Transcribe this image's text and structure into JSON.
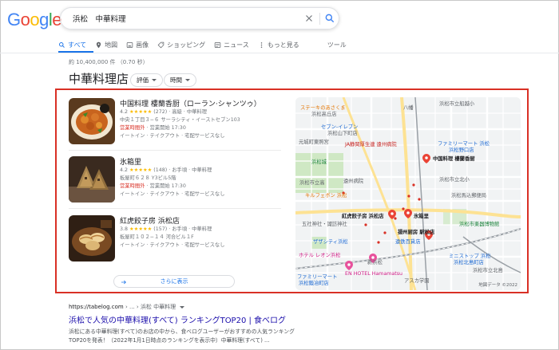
{
  "logo": "Google",
  "search": {
    "query": "浜松　中華料理"
  },
  "tabs": [
    {
      "label": "すべて",
      "icon": "search-icon"
    },
    {
      "label": "地図",
      "icon": "map-pin-icon"
    },
    {
      "label": "画像",
      "icon": "image-icon"
    },
    {
      "label": "ショッピング",
      "icon": "tag-icon"
    },
    {
      "label": "ニュース",
      "icon": "news-icon"
    },
    {
      "label": "もっと見る",
      "icon": "more-icon"
    },
    {
      "label": "ツール",
      "icon": ""
    }
  ],
  "result_count": "約 10,400,000 件 （0.70 秒）",
  "local_pack": {
    "heading": "中華料理店",
    "filters": [
      "評価",
      "時間"
    ],
    "places": [
      {
        "name": "中国料理 樓蘭香厨（ローラン·シャンツゥ）",
        "rating": "4.2",
        "stars": "★★★★★",
        "reviews": "(272)",
        "meta": " · 高級 · 中華料理",
        "address": "中央１丁目３−６ サーラシティ・イーストセブン103",
        "hours_status": "営業時間外",
        "hours_detail": " · 営業開始 17:30",
        "services": "イートイン · テイクアウト · 宅配サービスなし"
      },
      {
        "name": "氷箱里",
        "rating": "4.2",
        "stars": "★★★★★",
        "reviews": "(148)",
        "meta": " · お手頃 · 中華料理",
        "address": "板屋町６２８ Y3ビル5階",
        "hours_status": "営業時間外",
        "hours_detail": " · 営業開始 17:30",
        "services": "イートイン · テイクアウト · 宅配サービスなし"
      },
      {
        "name": "紅虎餃子房 浜松店",
        "rating": "3.8",
        "stars": "★★★★★",
        "reviews": "(157)",
        "meta": " · お手頃 · 中華料理",
        "address": "板屋町１０２−１４ 河合ビル１F",
        "hours_status": "",
        "hours_detail": "",
        "services": "イートイン · テイクアウト · 宅配サービスなし"
      }
    ],
    "more_label": "さらに表示"
  },
  "map": {
    "labels": {
      "steak": "ステーキのあさくま",
      "steak2": "浜松高丘店",
      "hachiman": "八幡",
      "hs1": "浜松市立船越小",
      "seven": "セブン-イレブン",
      "seven2": "浜松山下町店",
      "motoshiro": "元城町東照宮",
      "ja": "JA静岡厚生連 遠州病院",
      "familymart": "ファミリーマート 浜松",
      "familymart2": "浜松野口店",
      "hamamatsujo": "浜松城",
      "r1": "中国料理 樓蘭香厨",
      "hs2": "浜松市立北小",
      "hs_high": "浜松市立高",
      "ensyu": "遠州病院",
      "kirfaban": "キルフェボン 浜松",
      "sakanamachi": "浜松馬込郵便局",
      "r3": "紅虎餃子房 浜松店",
      "r2": "氷箱里",
      "gosha": "五社神社・諏訪神社",
      "gakki": "浜松市楽器博物館",
      "zaza": "ザザシティ浜松",
      "ngyuma": "揚州厨房 駅松店",
      "entetsu": "遠鉄百貨店",
      "hotel": "ホテル レオン浜松",
      "shinhama": "新浜松",
      "ministop": "ミニストップ 浜松",
      "ministop2": "浜松北島町店",
      "en_hotel": "EN HOTEL Hamamatsu",
      "family2": "ファミリーマート",
      "family3": "浜松鍛冶町店",
      "asuka": "アスカ学園",
      "hs4": "浜松市立北島",
      "copyright": "地図データ ©2022"
    }
  },
  "organic": {
    "url": "https://tabelog.com",
    "path": " › ... › 浜松 中華料理",
    "title": "浜松で人気の中華料理(すべて) ランキングTOP20 | 食べログ",
    "snippet1": "浜松にある中華料理(すべて)のお店の中から、食べログユーザーがおすすめの人気ランキング",
    "snippet2": "TOP20を発表！（2022年1月1日時点のランキングを表示中）中華料理(すべて) ..."
  }
}
